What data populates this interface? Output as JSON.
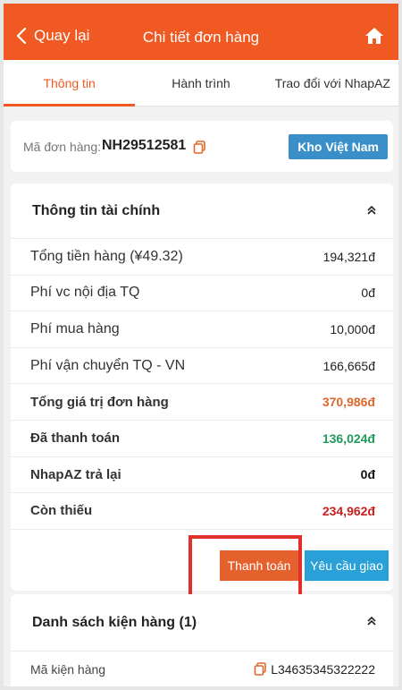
{
  "header": {
    "back_label": "Quay lại",
    "title": "Chi tiết đơn hàng"
  },
  "tabs": [
    {
      "label": "Thông tin",
      "active": true
    },
    {
      "label": "Hành trình",
      "active": false
    },
    {
      "label": "Trao đổi với NhapAZ",
      "active": false
    }
  ],
  "order": {
    "code_label": "Mã đơn hàng:",
    "code": "NH29512581",
    "warehouse": "Kho Việt Nam"
  },
  "finance": {
    "title": "Thông tin tài chính",
    "rows": [
      {
        "label": "Tổng tiền hàng (¥49.32)",
        "value": "194,321đ"
      },
      {
        "label": "Phí vc nội địa TQ",
        "value": "0đ"
      },
      {
        "label": "Phí mua hàng",
        "value": "10,000đ"
      },
      {
        "label": "Phí vận chuyển TQ - VN",
        "value": "166,665đ"
      },
      {
        "label": "Tổng giá trị đơn hàng",
        "value": "370,986đ"
      },
      {
        "label": "Đã thanh toán",
        "value": "136,024đ"
      },
      {
        "label": "NhapAZ trả lại",
        "value": "0đ"
      },
      {
        "label": "Còn thiếu",
        "value": "234,962đ"
      }
    ],
    "pay_button": "Thanh toán",
    "delivery_button": "Yêu cầu giao"
  },
  "packages": {
    "title": "Danh sách kiện hàng (1)",
    "rows": [
      {
        "label": "Mã kiện hàng",
        "value": "L34635345322222"
      }
    ]
  },
  "colors": {
    "brand": "#f05a22",
    "pay_button": "#e4612e",
    "delivery_button": "#2aa0d8",
    "warehouse_badge": "#3a8fc8",
    "total": "#e0662a",
    "paid": "#1f9a5a",
    "remaining": "#c9201f",
    "highlight_box": "#e0302a"
  },
  "icons": [
    "chevron-left-icon",
    "home-icon",
    "copy-icon",
    "chevron-up-icon"
  ]
}
